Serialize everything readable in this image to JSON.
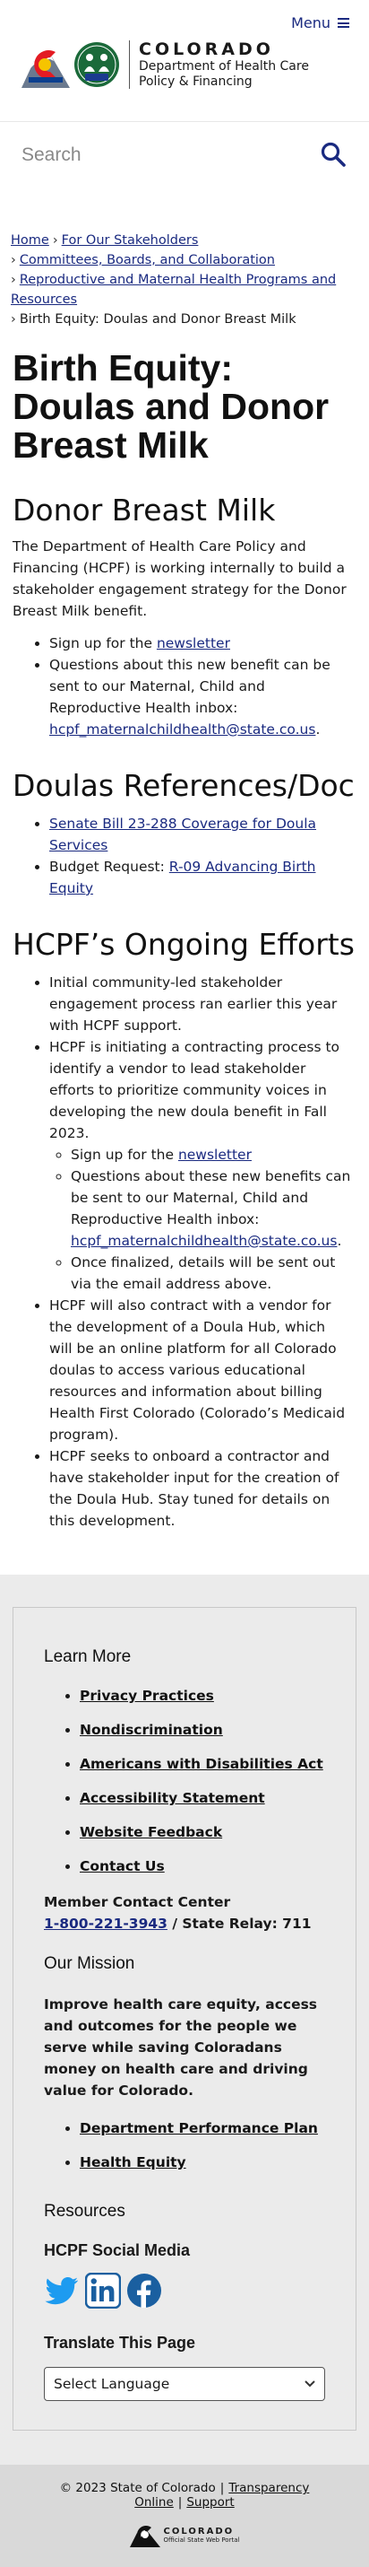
{
  "header": {
    "menu_label": "Menu",
    "logo_state": "COLORADO",
    "logo_dept_line1": "Department of Health Care",
    "logo_dept_line2": "Policy & Financing",
    "seal_text": "HCPF"
  },
  "search": {
    "placeholder": "Search"
  },
  "breadcrumbs": [
    {
      "label": "Home"
    },
    {
      "label": "For Our Stakeholders"
    },
    {
      "label": "Committees, Boards, and Collaboration"
    },
    {
      "label": "Reproductive and Maternal Health Programs and Resources"
    },
    {
      "label": "Birth Equity: Doulas and Donor Breast Milk"
    }
  ],
  "page_title": "Birth Equity: Doulas and Donor Breast Milk",
  "donor": {
    "heading": "Donor Breast Milk",
    "intro": "The Department of Health Care Policy and Financing (HCPF) is working internally to build a stakeholder engagement strategy for the Donor Breast Milk benefit.",
    "item1_prefix": "Sign up for the ",
    "item1_link": "newsletter",
    "item2_text": "Questions about this new benefit can be sent to our Maternal, Child and Reproductive Health inbox: ",
    "item2_link": "hcpf_maternalchildhealth@state.co.us",
    "item2_suffix": "."
  },
  "doulas": {
    "heading": "Doulas References/Documentation",
    "item1_link": "Senate Bill 23-288 Coverage for Doula Services",
    "item2_prefix": "Budget Request: ",
    "item2_link": "R-09 Advancing Birth Equity"
  },
  "efforts": {
    "heading": "HCPF’s Ongoing Efforts",
    "item1": "Initial community-led stakeholder engagement process ran earlier this year with HCPF support.",
    "item2": "HCPF is initiating a contracting process to identify a vendor to lead stakeholder efforts to prioritize community voices in developing the new doula benefit in Fall 2023.",
    "sub1_prefix": "Sign up for the ",
    "sub1_link": "newsletter",
    "sub2_text": "Questions about these new benefits can be sent to our Maternal, Child and Reproductive Health inbox: ",
    "sub2_link": "hcpf_maternalchildhealth@state.co.us",
    "sub2_suffix": ".",
    "sub3": "Once finalized, details will be sent out via the email address above.",
    "item3": "HCPF will also contract with a vendor for the development of a Doula Hub, which will be an online platform for all Colorado doulas to access various educational resources and information about billing Health First Colorado (Colorado’s Medicaid program).",
    "item4": "HCPF seeks to onboard a contractor and have stakeholder input for the creation of the Doula Hub. Stay tuned for details on this development."
  },
  "footer": {
    "learn_more_heading": "Learn More",
    "learn_more_links": [
      "Privacy Practices",
      "Nondiscrimination",
      "Americans with Disabilities Act",
      "Accessibility Statement",
      "Website Feedback",
      "Contact Us"
    ],
    "contact_label": "Member Contact Center",
    "contact_phone": "1-800-221-3943",
    "contact_relay": " / State Relay: 711",
    "mission_heading": "Our Mission",
    "mission_text": "Improve health care equity, access and outcomes for the people we serve while saving Coloradans money on health care and driving value for Colorado.",
    "mission_links": [
      "Department Performance Plan",
      "Health Equity"
    ],
    "resources_heading": "Resources",
    "social_heading": "HCPF Social Media",
    "translate_heading": "Translate This Page",
    "translate_select": "Select Language",
    "copyright": "© 2023 State of Colorado",
    "transparency": "Transparency Online",
    "support": "Support",
    "portal_state": "COLORADO",
    "portal_sub": "Official State Web Portal"
  },
  "colors": {
    "link": "#1a2a80",
    "footer_bg": "#ebebeb",
    "bottom_bar_bg": "#d9d9d9"
  }
}
